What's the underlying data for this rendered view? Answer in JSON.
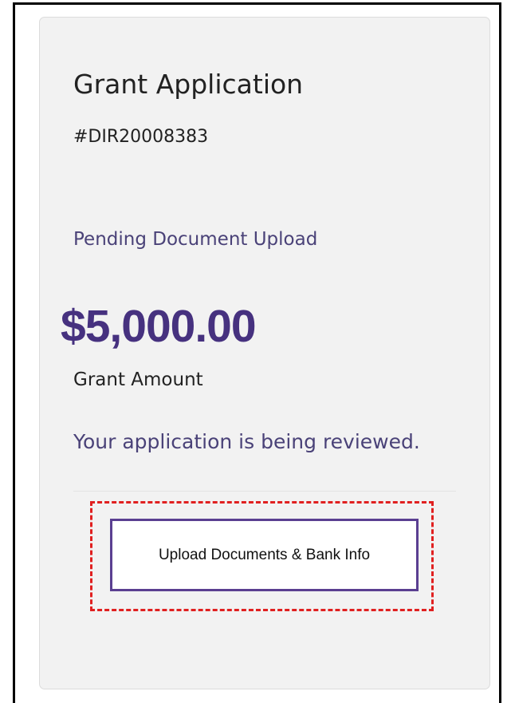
{
  "card": {
    "title": "Grant Application",
    "application_id": "#DIR20008383",
    "status": "Pending Document Upload",
    "amount": "$5,000.00",
    "amount_label": "Grant Amount",
    "message": "Your application is being reviewed.",
    "upload_button_label": "Upload Documents & Bank Info"
  },
  "colors": {
    "accent": "#46317f",
    "status_text": "#4a4278",
    "highlight": "#e02020",
    "card_background": "#f2f2f2"
  }
}
